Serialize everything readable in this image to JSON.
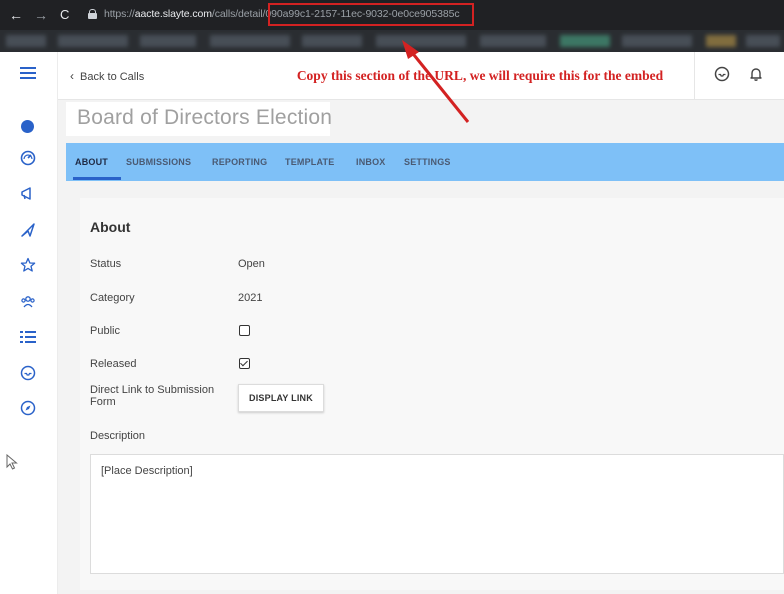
{
  "browser": {
    "nav_back": "←",
    "nav_forward": "→",
    "nav_reload": "C",
    "url_prefix": "https://",
    "url_host": "aacte.slayte.com",
    "url_path": "/calls/detail/",
    "url_id": "090a99c1-2157-11ec-9032-0e0ce905385c"
  },
  "rail": {
    "icons": [
      "menu-icon",
      "dot-icon",
      "dashboard-icon",
      "megaphone-icon",
      "send-icon",
      "star-icon",
      "people-icon",
      "list-icon",
      "inbox-icon",
      "compass-icon"
    ]
  },
  "topbar": {
    "back_link": "Back to Calls",
    "icons": [
      "inbox-icon",
      "bell-icon"
    ]
  },
  "page": {
    "title": "Board of Directors Election"
  },
  "annotation": {
    "text": "Copy this section of the URL, we will require this for the embed",
    "color": "#d32222"
  },
  "tabs": [
    {
      "label": "ABOUT",
      "active": true
    },
    {
      "label": "SUBMISSIONS",
      "active": false
    },
    {
      "label": "REPORTING",
      "active": false
    },
    {
      "label": "TEMPLATE",
      "active": false
    },
    {
      "label": "INBOX",
      "active": false
    },
    {
      "label": "SETTINGS",
      "active": false
    }
  ],
  "about": {
    "heading": "About",
    "status_label": "Status",
    "status_value": "Open",
    "category_label": "Category",
    "category_value": "2021",
    "public_label": "Public",
    "public_checked": false,
    "released_label": "Released",
    "released_checked": true,
    "direct_link_label": "Direct Link to Submission Form",
    "display_link_button": "DISPLAY LINK",
    "description_label": "Description",
    "description_value": "[Place Description]"
  },
  "colors": {
    "accent": "#2a62c9",
    "tab_bar": "#7ec0f7",
    "highlight": "#d32222"
  }
}
